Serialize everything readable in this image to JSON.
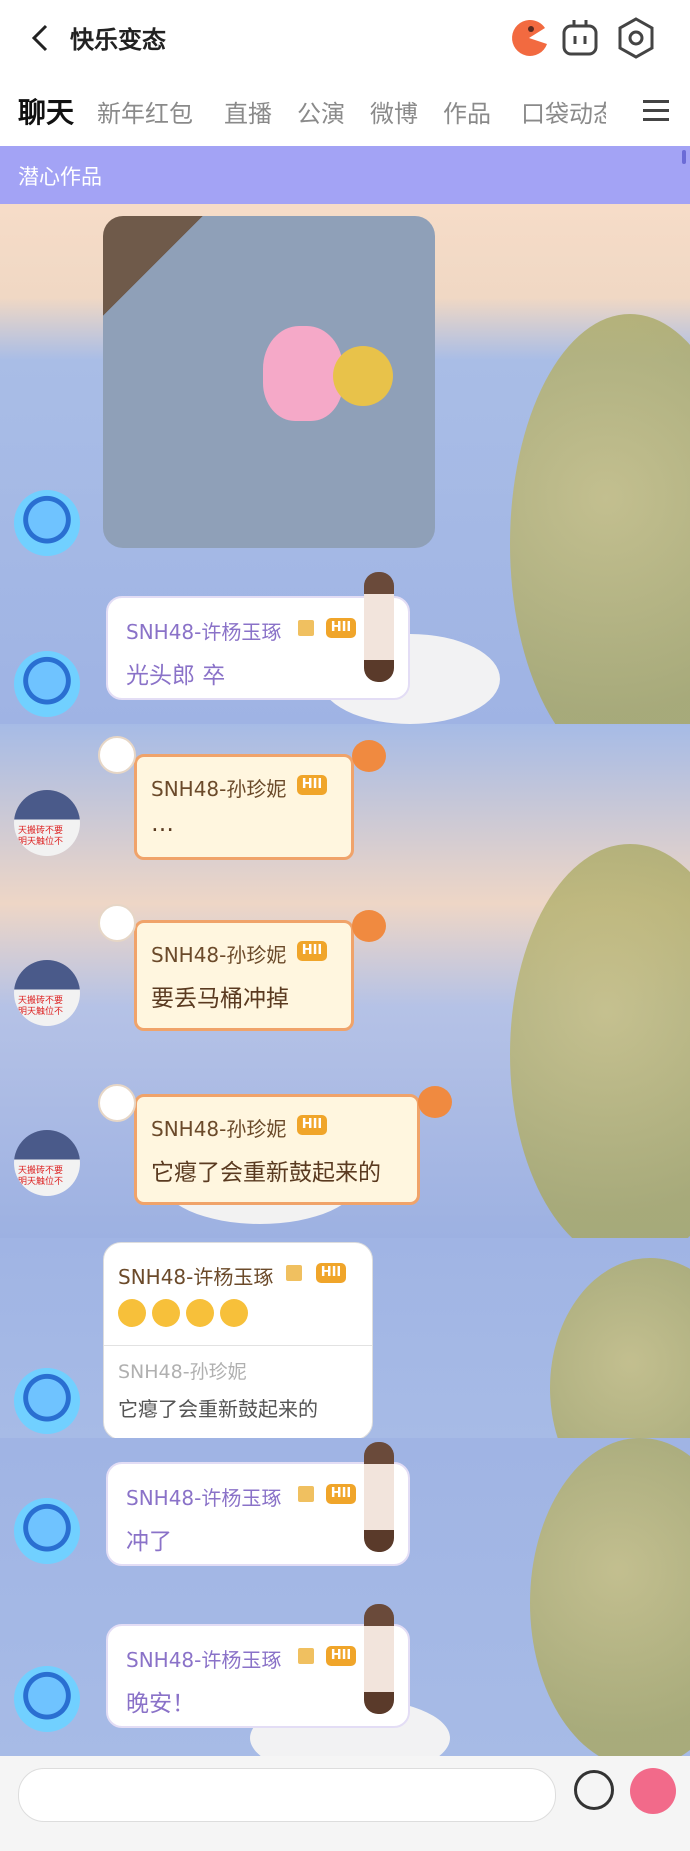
{
  "header": {
    "title": "快乐变态"
  },
  "tabs": [
    {
      "label": "聊天"
    },
    {
      "label": "新年红包"
    },
    {
      "label": "直播"
    },
    {
      "label": "公演"
    },
    {
      "label": "微博"
    },
    {
      "label": "作品"
    },
    {
      "label": "口袋动态"
    }
  ],
  "banner": {
    "label": "潜心作品"
  },
  "messages": [
    {
      "type": "image",
      "avatar": "avatar-blue-character"
    },
    {
      "sender": "SNH48-许杨玉琢",
      "level": "HII",
      "text": "光头郎 卒"
    },
    {
      "sender": "SNH48-孙珍妮",
      "level": "HII",
      "text": "…"
    },
    {
      "sender": "SNH48-孙珍妮",
      "level": "HII",
      "text": "要丢马桶冲掉"
    },
    {
      "sender": "SNH48-孙珍妮",
      "level": "HII",
      "text": "它瘪了会重新鼓起来的"
    },
    {
      "sender": "SNH48-许杨玉琢",
      "level": "HII",
      "quote_name": "SNH48-孙珍妮",
      "quote_text": "它瘪了会重新鼓起来的"
    },
    {
      "sender": "SNH48-许杨玉琢",
      "level": "HII",
      "text": "冲了"
    },
    {
      "sender": "SNH48-许杨玉琢",
      "level": "HII",
      "text": "晚安！"
    }
  ],
  "avatar_b_tag": "天搬砖不要\n明天触位不",
  "colors": {
    "accent": "#a3a3f5",
    "level_badge": "#f0a52a",
    "purple_text": "#8a72c8"
  }
}
